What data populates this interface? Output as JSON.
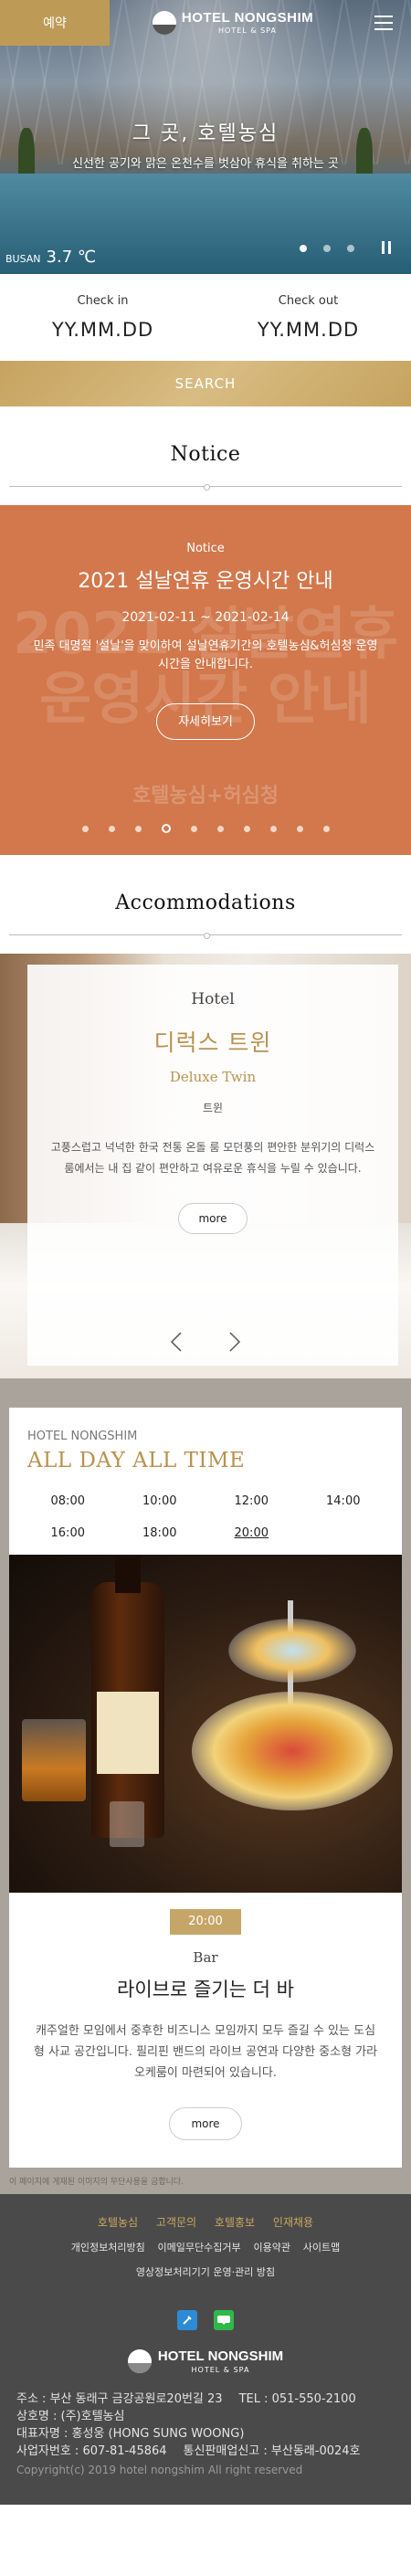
{
  "header": {
    "reserve_label": "예약",
    "brand_name": "HOTEL NONGSHIM",
    "brand_sub": "HOTEL & SPA"
  },
  "hero": {
    "title": "그 곳, 호텔농심",
    "subtitle": "신선한 공기와 맑은 온천수를 벗삼아 휴식을 취하는 곳",
    "weather_city": "BUSAN",
    "weather_temp": "3.7 ℃",
    "slide_count": 4,
    "active_slide": 1
  },
  "booking": {
    "checkin_label": "Check in",
    "checkin_value": "YY.MM.DD",
    "checkout_label": "Check out",
    "checkout_value": "YY.MM.DD",
    "search_label": "SEARCH"
  },
  "notice": {
    "heading": "Notice",
    "kicker": "Notice",
    "title": "2021 설날연휴 운영시간 안내",
    "date_range": "2021-02-11 ~ 2021-02-14",
    "description": "민족 대명절 '설날'을 맞이하여 설날연휴기간의 호텔농심&허심청 운영시간을 안내합니다.",
    "more_label": "자세히보기",
    "watermark_line1": "2021 설날연휴",
    "watermark_line2": "운영시간 안내",
    "watermark_brand": "호텔농심+허심청",
    "page_count": 10,
    "active_page": 4
  },
  "accommodations": {
    "heading": "Accommodations",
    "kind": "Hotel",
    "room_name_kr": "디럭스 트윈",
    "room_name_en": "Deluxe Twin",
    "room_type": "트윈",
    "description": "고풍스럽고 넉넉한 한국 전통 온돌 룸 모던풍의 편안한 분위기의 디럭스 룸에서는 내 집 같이 편안하고 여유로운 휴식을 누릴 수 있습니다.",
    "more_label": "more"
  },
  "dining": {
    "hotel_label": "HOTEL NONGSHIM",
    "tagline": "ALL DAY ALL TIME",
    "times": [
      "08:00",
      "10:00",
      "12:00",
      "14:00",
      "16:00",
      "18:00",
      "20:00"
    ],
    "active_time": "20:00",
    "badge": "20:00",
    "kind": "Bar",
    "name": "라이브로 즐기는 더 바",
    "description": "캐주얼한 모임에서 중후한 비즈니스 모임까지 모두 즐길 수 있는 도심형 사교 공간입니다. 필리핀 밴드의 라이브 공연과 다양한 중소형 가라오케룸이 마련되어 있습니다.",
    "more_label": "more",
    "copy_note": "이 페이지에 게재된 이미지의 무단사용을 금합니다."
  },
  "footer": {
    "menu_primary": [
      "호텔농심",
      "고객문의",
      "호텔홍보",
      "인재채용"
    ],
    "menu_secondary": [
      "개인정보처리방침",
      "이메일무단수집거부",
      "이용약관",
      "사이트맵"
    ],
    "menu_tertiary": [
      "영상정보처리기기 운영·관리 방침"
    ],
    "brand_name": "HOTEL NONGSHIM",
    "brand_sub": "HOTEL & SPA",
    "address": "주소 : 부산 동래구 금강공원로20번길 23",
    "tel": "TEL : 051-550-2100",
    "company": "상호명 : (주)호텔농심",
    "ceo": "대표자명 : 홍성웅 (HONG SUNG WOONG)",
    "biz_no": "사업자번호 : 607-81-45864",
    "mail_order": "통신판매업신고 : 부산동래-0024호",
    "copyright": "Copyright(c) 2019 hotel nongshim All right reserved"
  },
  "colors": {
    "gold": "#bd9b56",
    "notice_bg": "#d2784c",
    "footer_bg": "#4a4a4a",
    "section_gray": "#a9a39b"
  }
}
